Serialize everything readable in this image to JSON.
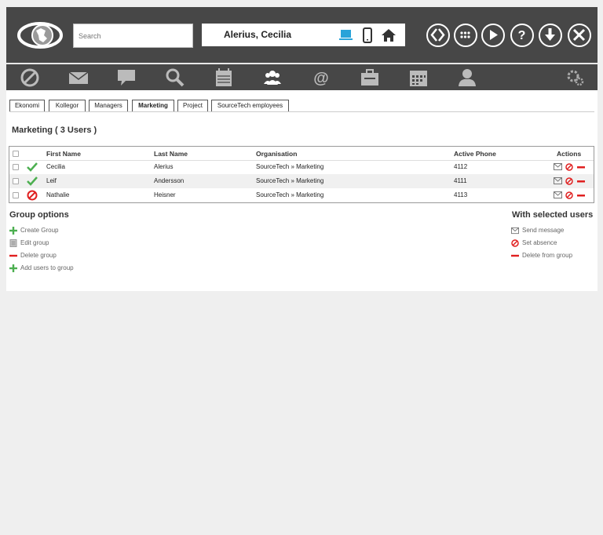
{
  "search": {
    "placeholder": "Search"
  },
  "header": {
    "user_name": "Alerius, Cecilia",
    "device_icons": [
      "computer-icon",
      "mobile-phone-icon",
      "home-icon"
    ],
    "buttons": [
      "switch-icon",
      "apps-grid-icon",
      "play-icon",
      "help-icon",
      "download-icon",
      "close-icon"
    ]
  },
  "toolbar": {
    "icons": [
      "absence-icon",
      "mail-icon",
      "chat-icon",
      "search-icon",
      "calendar-icon",
      "groups-icon",
      "at-icon",
      "briefcase-icon",
      "schedule-icon",
      "user-icon",
      "settings-icon"
    ]
  },
  "tabs": [
    "Ekonomi",
    "Kollegor",
    "Managers",
    "Marketing",
    "Project",
    "SourceTech employees"
  ],
  "active_tab": "Marketing",
  "group_title": "Marketing ( 3 Users )",
  "table": {
    "columns": [
      "First Name",
      "Last Name",
      "Organisation",
      "Active Phone",
      "Actions"
    ],
    "rows": [
      {
        "status": "available",
        "first": "Cecilia",
        "last": "Alerius",
        "org": "SourceTech » Marketing",
        "phone": "4112"
      },
      {
        "status": "available",
        "first": "Leif",
        "last": "Andersson",
        "org": "SourceTech » Marketing",
        "phone": "4111"
      },
      {
        "status": "absent",
        "first": "Nathalie",
        "last": "Heisner",
        "org": "SourceTech » Marketing",
        "phone": "4113"
      }
    ]
  },
  "group_options": {
    "title": "Group options",
    "items": [
      "Create Group",
      "Edit group",
      "Delete group",
      "Add users to group"
    ]
  },
  "selected_users": {
    "title": "With selected users",
    "items": [
      "Send message",
      "Set absence",
      "Delete from group"
    ]
  },
  "colors": {
    "header_bg": "#474747",
    "accent_green": "#4caf50",
    "absence_red": "#e02020",
    "device_blue": "#29a3d9"
  }
}
